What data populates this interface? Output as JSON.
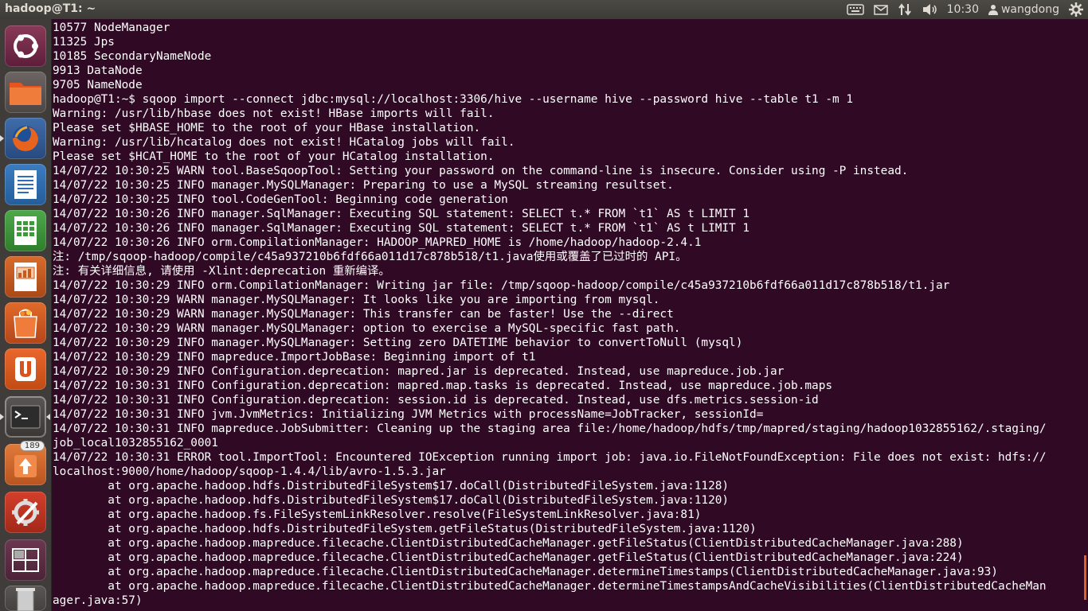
{
  "window": {
    "title": "hadoop@T1: ~"
  },
  "panel": {
    "time": "10:30",
    "user": "wangdong"
  },
  "launcher": {
    "items": [
      {
        "name": "dash-home-button"
      },
      {
        "name": "files-app-button"
      },
      {
        "name": "firefox-app-button"
      },
      {
        "name": "writer-app-button"
      },
      {
        "name": "calc-app-button"
      },
      {
        "name": "impress-app-button"
      },
      {
        "name": "software-center-button"
      },
      {
        "name": "ubuntu-one-button"
      },
      {
        "name": "terminal-app-button"
      },
      {
        "name": "update-manager-button",
        "badge": "189"
      },
      {
        "name": "system-settings-button"
      },
      {
        "name": "workspace-switcher-button"
      },
      {
        "name": "trash-button"
      }
    ]
  },
  "terminal": {
    "lines": [
      "10577 NodeManager",
      "11325 Jps",
      "10185 SecondaryNameNode",
      "9913 DataNode",
      "9705 NameNode",
      "hadoop@T1:~$ sqoop import --connect jdbc:mysql://localhost:3306/hive --username hive --password hive --table t1 -m 1",
      "Warning: /usr/lib/hbase does not exist! HBase imports will fail.",
      "Please set $HBASE_HOME to the root of your HBase installation.",
      "Warning: /usr/lib/hcatalog does not exist! HCatalog jobs will fail.",
      "Please set $HCAT_HOME to the root of your HCatalog installation.",
      "14/07/22 10:30:25 WARN tool.BaseSqoopTool: Setting your password on the command-line is insecure. Consider using -P instead.",
      "14/07/22 10:30:25 INFO manager.MySQLManager: Preparing to use a MySQL streaming resultset.",
      "14/07/22 10:30:25 INFO tool.CodeGenTool: Beginning code generation",
      "14/07/22 10:30:26 INFO manager.SqlManager: Executing SQL statement: SELECT t.* FROM `t1` AS t LIMIT 1",
      "14/07/22 10:30:26 INFO manager.SqlManager: Executing SQL statement: SELECT t.* FROM `t1` AS t LIMIT 1",
      "14/07/22 10:30:26 INFO orm.CompilationManager: HADOOP_MAPRED_HOME is /home/hadoop/hadoop-2.4.1",
      "注: /tmp/sqoop-hadoop/compile/c45a937210b6fdf66a011d17c878b518/t1.java使用或覆盖了已过时的 API。",
      "注: 有关详细信息, 请使用 -Xlint:deprecation 重新编译。",
      "14/07/22 10:30:29 INFO orm.CompilationManager: Writing jar file: /tmp/sqoop-hadoop/compile/c45a937210b6fdf66a011d17c878b518/t1.jar",
      "14/07/22 10:30:29 WARN manager.MySQLManager: It looks like you are importing from mysql.",
      "14/07/22 10:30:29 WARN manager.MySQLManager: This transfer can be faster! Use the --direct",
      "14/07/22 10:30:29 WARN manager.MySQLManager: option to exercise a MySQL-specific fast path.",
      "14/07/22 10:30:29 INFO manager.MySQLManager: Setting zero DATETIME behavior to convertToNull (mysql)",
      "14/07/22 10:30:29 INFO mapreduce.ImportJobBase: Beginning import of t1",
      "14/07/22 10:30:29 INFO Configuration.deprecation: mapred.jar is deprecated. Instead, use mapreduce.job.jar",
      "14/07/22 10:30:31 INFO Configuration.deprecation: mapred.map.tasks is deprecated. Instead, use mapreduce.job.maps",
      "14/07/22 10:30:31 INFO Configuration.deprecation: session.id is deprecated. Instead, use dfs.metrics.session-id",
      "14/07/22 10:30:31 INFO jvm.JvmMetrics: Initializing JVM Metrics with processName=JobTracker, sessionId=",
      "14/07/22 10:30:31 INFO mapreduce.JobSubmitter: Cleaning up the staging area file:/home/hadoop/hdfs/tmp/mapred/staging/hadoop1032855162/.staging/",
      "job_local1032855162_0001",
      "14/07/22 10:30:31 ERROR tool.ImportTool: Encountered IOException running import job: java.io.FileNotFoundException: File does not exist: hdfs://",
      "localhost:9000/home/hadoop/sqoop-1.4.4/lib/avro-1.5.3.jar",
      "        at org.apache.hadoop.hdfs.DistributedFileSystem$17.doCall(DistributedFileSystem.java:1128)",
      "        at org.apache.hadoop.hdfs.DistributedFileSystem$17.doCall(DistributedFileSystem.java:1120)",
      "        at org.apache.hadoop.fs.FileSystemLinkResolver.resolve(FileSystemLinkResolver.java:81)",
      "        at org.apache.hadoop.hdfs.DistributedFileSystem.getFileStatus(DistributedFileSystem.java:1120)",
      "        at org.apache.hadoop.mapreduce.filecache.ClientDistributedCacheManager.getFileStatus(ClientDistributedCacheManager.java:288)",
      "        at org.apache.hadoop.mapreduce.filecache.ClientDistributedCacheManager.getFileStatus(ClientDistributedCacheManager.java:224)",
      "        at org.apache.hadoop.mapreduce.filecache.ClientDistributedCacheManager.determineTimestamps(ClientDistributedCacheManager.java:93)",
      "        at org.apache.hadoop.mapreduce.filecache.ClientDistributedCacheManager.determineTimestampsAndCacheVisibilities(ClientDistributedCacheMan",
      "ager.java:57)"
    ]
  }
}
